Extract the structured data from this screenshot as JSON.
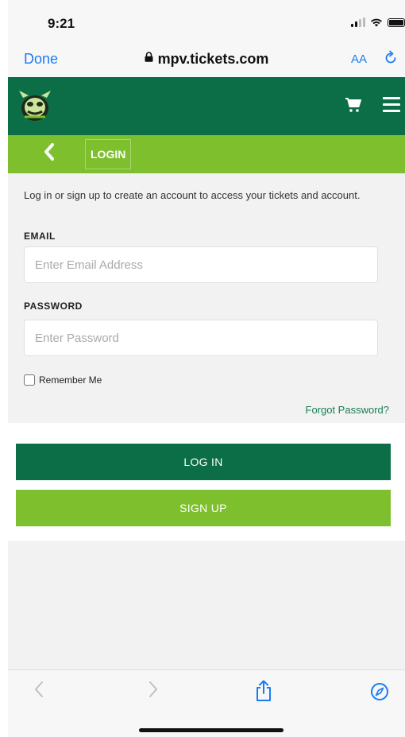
{
  "status_bar": {
    "time": "9:21"
  },
  "browser": {
    "done_label": "Done",
    "url": "mpv.tickets.com",
    "text_size_label": "AA",
    "icons": [
      "lock-icon",
      "reload-icon"
    ]
  },
  "header": {
    "logo": "hornet-logo",
    "icons": [
      "cart-icon",
      "menu-icon"
    ]
  },
  "subnav": {
    "back_icon": "chevron-left-icon",
    "title": "LOGIN"
  },
  "form": {
    "intro": "Log in or sign up to create an account to access your tickets and account.",
    "email_label": "EMAIL",
    "email_placeholder": "Enter Email Address",
    "email_value": "",
    "password_label": "PASSWORD",
    "password_placeholder": "Enter Password",
    "password_value": "",
    "remember_label": "Remember Me",
    "remember_checked": false,
    "forgot_label": "Forgot Password?"
  },
  "actions": {
    "login_label": "LOG IN",
    "signup_label": "SIGN UP"
  },
  "toolbar": {
    "back_glyph": "<",
    "forward_glyph": ">",
    "icons": [
      "back-icon",
      "forward-icon",
      "share-icon",
      "compass-icon"
    ]
  },
  "colors": {
    "brand_dark_green": "#0c6e47",
    "brand_light_green": "#7dbf2c",
    "link_blue": "#1a7cf5",
    "forgot_link": "#1a7c52"
  }
}
